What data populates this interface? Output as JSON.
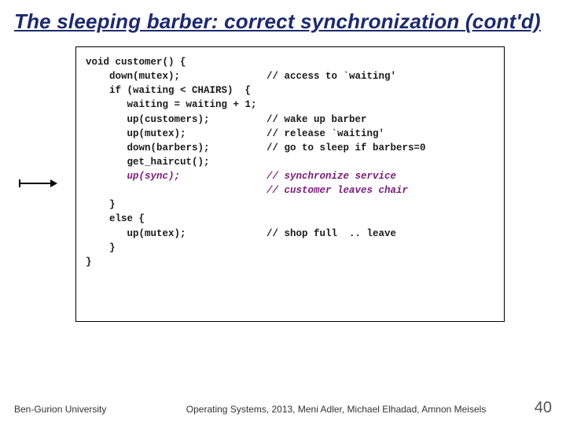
{
  "title_main": "The sleeping barber: correct synchronization",
  "title_contd": "(cont'd)",
  "code": {
    "l00": "void customer() {",
    "l01": "    down(mutex);",
    "c01": "// access to `waiting'",
    "l02": "    if (waiting < CHAIRS)  {",
    "l03": "       waiting = waiting + 1;",
    "l04": "       up(customers);",
    "c04": "// wake up barber",
    "l05": "       up(mutex);",
    "c05": "// release `waiting'",
    "l06": "       down(barbers);",
    "c06": "// go to sleep if barbers=0",
    "l07": "       get_haircut();",
    "l08": "",
    "l09": "       up(sync);",
    "c09a": "// synchronize service",
    "c09b": "// customer leaves chair",
    "l10": "    }",
    "l11": "    else {",
    "l12": "       up(mutex);",
    "c12": "// shop full  .. leave",
    "l13": "    }",
    "l14": "}"
  },
  "footer": {
    "university": "Ben-Gurion University",
    "course": "Operating Systems, 2013, Meni Adler, Michael Elhadad, Amnon Meisels",
    "page": "40"
  }
}
